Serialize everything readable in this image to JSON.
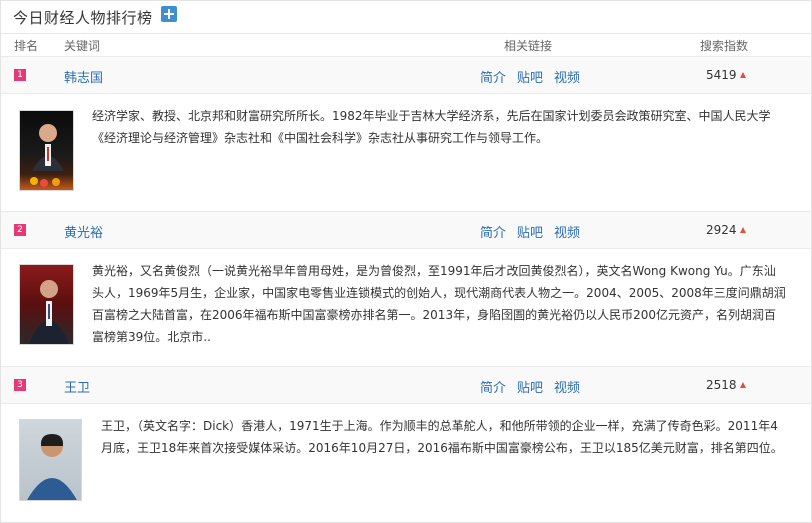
{
  "panel": {
    "title": "今日财经人物排行榜"
  },
  "columns": {
    "rank": "排名",
    "keyword": "关键词",
    "links": "相关链接",
    "index": "搜索指数"
  },
  "entries": [
    {
      "rank": "1",
      "name": "韩志国",
      "links": [
        "简介",
        "贴吧",
        "视频"
      ],
      "score": "5419",
      "description": "经济学家、教授、北京邦和财富研究所所长。1982年毕业于吉林大学经济系，先后在国家计划委员会政策研究室、中国人民大学《经济理论与经济管理》杂志社和《中国社会科学》杂志社从事研究工作与领导工作。"
    },
    {
      "rank": "2",
      "name": "黄光裕",
      "links": [
        "简介",
        "贴吧",
        "视频"
      ],
      "score": "2924",
      "description": "黄光裕，又名黄俊烈（一说黄光裕早年曾用母姓，是为曾俊烈，至1991年后才改回黄俊烈名），英文名Wong Kwong Yu。广东汕头人，1969年5月生，企业家，中国家电零售业连锁模式的创始人，现代潮商代表人物之一。2004、2005、2008年三度问鼎胡润百富榜之大陆首富，在2006年福布斯中国富豪榜亦排名第一。2013年，身陷囹圄的黄光裕仍以人民币200亿元资产，名列胡润百富榜第39位。北京市.."
    },
    {
      "rank": "3",
      "name": "王卫",
      "links": [
        "简介",
        "贴吧",
        "视频"
      ],
      "score": "2518",
      "description": "王卫，（英文名字：Dick）香港人，1971生于上海。作为顺丰的总革舵人，和他所带领的企业一样，充满了传奇色彩。2011年4月底，王卫18年来首次接受媒体采访。2016年10月27日，2016福布斯中国富豪榜公布，王卫以185亿美元财富，排名第四位。"
    }
  ]
}
